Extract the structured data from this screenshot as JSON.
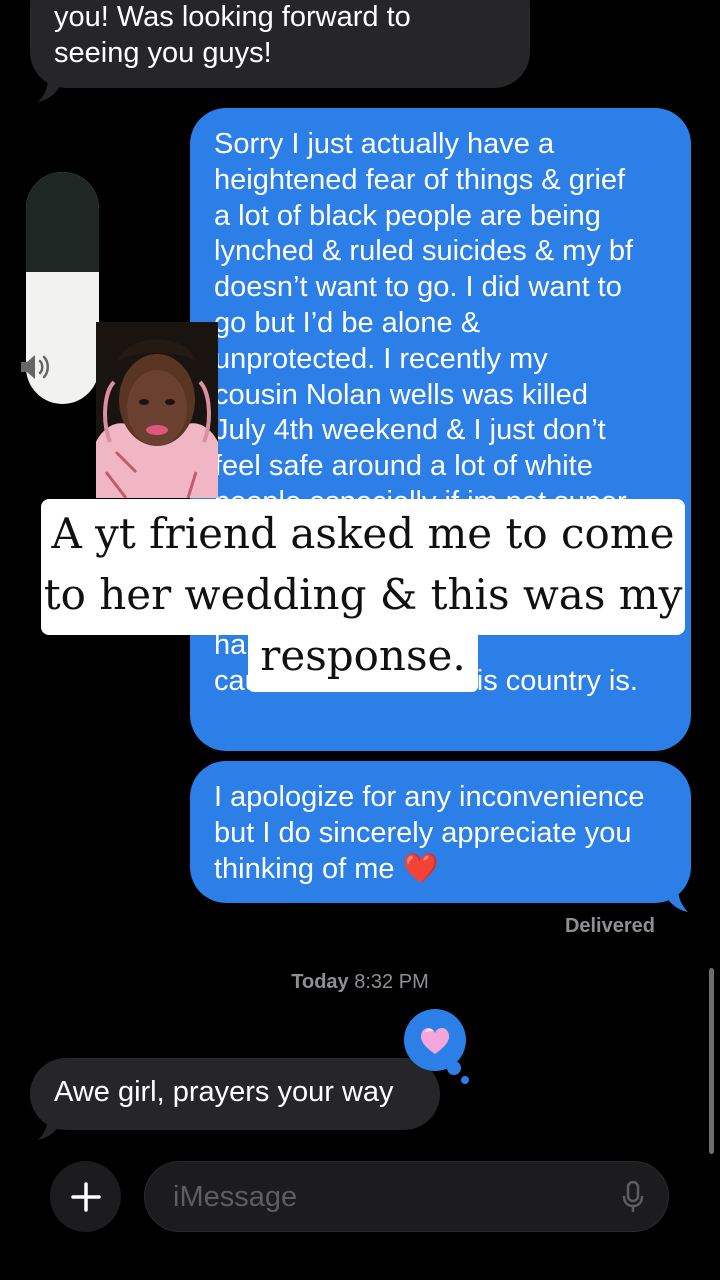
{
  "messages": {
    "incoming_top": "you! Was looking forward to\nseeing you guys!",
    "outgoing_long": "Sorry I just actually have a\nheightened  fear of things & grief\na lot of black people are being\nlynched & ruled suicides & my bf\ndoesn’t want to go. I did want to\ngo but I’d be alone &\nunprotected. I recently my\ncousin Nolan wells was killed\nJuly  4th weekend  &  I just don’t\nfeel safe around a lot of white\npeople especially if im not super\n\n\nmi                              out I just now\nha                              my welfare\ncause I know how this country is.",
    "outgoing_apology": "I apologize for any inconvenience\nbut I do sincerely appreciate you\nthinking of me ❤️",
    "incoming_reply": "Awe girl, prayers your way"
  },
  "status": {
    "delivered": "Delivered",
    "timestamp_day": "Today",
    "timestamp_time": "8:32 PM"
  },
  "overlay": {
    "caption": "A yt friend asked me to come\nto her wedding & this was my\nresponse."
  },
  "input": {
    "placeholder": "iMessage"
  },
  "icons": {
    "plus": "plus-icon",
    "mic": "microphone-icon",
    "volume": "speaker-icon",
    "tapback": "heart-icon"
  },
  "colors": {
    "outgoing_bubble": "#2b7fe6",
    "incoming_bubble": "#262628",
    "background": "#000000"
  }
}
